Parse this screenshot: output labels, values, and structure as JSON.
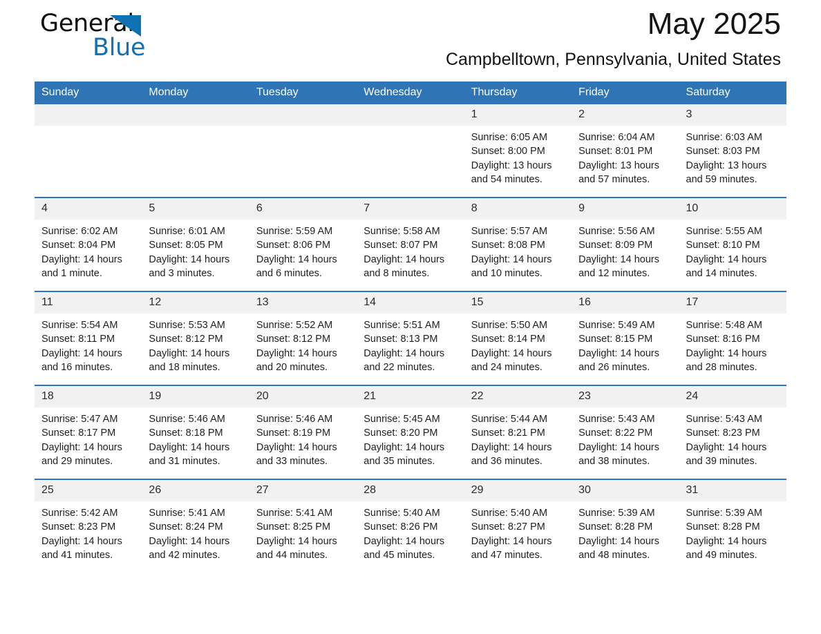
{
  "brand": {
    "name_part1": "General",
    "name_part2": "Blue",
    "triangle_icon": "triangle-logo-icon",
    "accent_color": "#0f72b5"
  },
  "header": {
    "title": "May 2025",
    "subtitle": "Campbelltown, Pennsylvania, United States",
    "header_bg_color": "#2f75b5",
    "daynum_bg_color": "#f1f1f1"
  },
  "weekday_headers": [
    "Sunday",
    "Monday",
    "Tuesday",
    "Wednesday",
    "Thursday",
    "Friday",
    "Saturday"
  ],
  "weeks": [
    [
      {
        "day": "",
        "lines": []
      },
      {
        "day": "",
        "lines": []
      },
      {
        "day": "",
        "lines": []
      },
      {
        "day": "",
        "lines": []
      },
      {
        "day": "1",
        "lines": [
          "Sunrise: 6:05 AM",
          "Sunset: 8:00 PM",
          "Daylight: 13 hours and 54 minutes."
        ]
      },
      {
        "day": "2",
        "lines": [
          "Sunrise: 6:04 AM",
          "Sunset: 8:01 PM",
          "Daylight: 13 hours and 57 minutes."
        ]
      },
      {
        "day": "3",
        "lines": [
          "Sunrise: 6:03 AM",
          "Sunset: 8:03 PM",
          "Daylight: 13 hours and 59 minutes."
        ]
      }
    ],
    [
      {
        "day": "4",
        "lines": [
          "Sunrise: 6:02 AM",
          "Sunset: 8:04 PM",
          "Daylight: 14 hours and 1 minute."
        ]
      },
      {
        "day": "5",
        "lines": [
          "Sunrise: 6:01 AM",
          "Sunset: 8:05 PM",
          "Daylight: 14 hours and 3 minutes."
        ]
      },
      {
        "day": "6",
        "lines": [
          "Sunrise: 5:59 AM",
          "Sunset: 8:06 PM",
          "Daylight: 14 hours and 6 minutes."
        ]
      },
      {
        "day": "7",
        "lines": [
          "Sunrise: 5:58 AM",
          "Sunset: 8:07 PM",
          "Daylight: 14 hours and 8 minutes."
        ]
      },
      {
        "day": "8",
        "lines": [
          "Sunrise: 5:57 AM",
          "Sunset: 8:08 PM",
          "Daylight: 14 hours and 10 minutes."
        ]
      },
      {
        "day": "9",
        "lines": [
          "Sunrise: 5:56 AM",
          "Sunset: 8:09 PM",
          "Daylight: 14 hours and 12 minutes."
        ]
      },
      {
        "day": "10",
        "lines": [
          "Sunrise: 5:55 AM",
          "Sunset: 8:10 PM",
          "Daylight: 14 hours and 14 minutes."
        ]
      }
    ],
    [
      {
        "day": "11",
        "lines": [
          "Sunrise: 5:54 AM",
          "Sunset: 8:11 PM",
          "Daylight: 14 hours and 16 minutes."
        ]
      },
      {
        "day": "12",
        "lines": [
          "Sunrise: 5:53 AM",
          "Sunset: 8:12 PM",
          "Daylight: 14 hours and 18 minutes."
        ]
      },
      {
        "day": "13",
        "lines": [
          "Sunrise: 5:52 AM",
          "Sunset: 8:12 PM",
          "Daylight: 14 hours and 20 minutes."
        ]
      },
      {
        "day": "14",
        "lines": [
          "Sunrise: 5:51 AM",
          "Sunset: 8:13 PM",
          "Daylight: 14 hours and 22 minutes."
        ]
      },
      {
        "day": "15",
        "lines": [
          "Sunrise: 5:50 AM",
          "Sunset: 8:14 PM",
          "Daylight: 14 hours and 24 minutes."
        ]
      },
      {
        "day": "16",
        "lines": [
          "Sunrise: 5:49 AM",
          "Sunset: 8:15 PM",
          "Daylight: 14 hours and 26 minutes."
        ]
      },
      {
        "day": "17",
        "lines": [
          "Sunrise: 5:48 AM",
          "Sunset: 8:16 PM",
          "Daylight: 14 hours and 28 minutes."
        ]
      }
    ],
    [
      {
        "day": "18",
        "lines": [
          "Sunrise: 5:47 AM",
          "Sunset: 8:17 PM",
          "Daylight: 14 hours and 29 minutes."
        ]
      },
      {
        "day": "19",
        "lines": [
          "Sunrise: 5:46 AM",
          "Sunset: 8:18 PM",
          "Daylight: 14 hours and 31 minutes."
        ]
      },
      {
        "day": "20",
        "lines": [
          "Sunrise: 5:46 AM",
          "Sunset: 8:19 PM",
          "Daylight: 14 hours and 33 minutes."
        ]
      },
      {
        "day": "21",
        "lines": [
          "Sunrise: 5:45 AM",
          "Sunset: 8:20 PM",
          "Daylight: 14 hours and 35 minutes."
        ]
      },
      {
        "day": "22",
        "lines": [
          "Sunrise: 5:44 AM",
          "Sunset: 8:21 PM",
          "Daylight: 14 hours and 36 minutes."
        ]
      },
      {
        "day": "23",
        "lines": [
          "Sunrise: 5:43 AM",
          "Sunset: 8:22 PM",
          "Daylight: 14 hours and 38 minutes."
        ]
      },
      {
        "day": "24",
        "lines": [
          "Sunrise: 5:43 AM",
          "Sunset: 8:23 PM",
          "Daylight: 14 hours and 39 minutes."
        ]
      }
    ],
    [
      {
        "day": "25",
        "lines": [
          "Sunrise: 5:42 AM",
          "Sunset: 8:23 PM",
          "Daylight: 14 hours and 41 minutes."
        ]
      },
      {
        "day": "26",
        "lines": [
          "Sunrise: 5:41 AM",
          "Sunset: 8:24 PM",
          "Daylight: 14 hours and 42 minutes."
        ]
      },
      {
        "day": "27",
        "lines": [
          "Sunrise: 5:41 AM",
          "Sunset: 8:25 PM",
          "Daylight: 14 hours and 44 minutes."
        ]
      },
      {
        "day": "28",
        "lines": [
          "Sunrise: 5:40 AM",
          "Sunset: 8:26 PM",
          "Daylight: 14 hours and 45 minutes."
        ]
      },
      {
        "day": "29",
        "lines": [
          "Sunrise: 5:40 AM",
          "Sunset: 8:27 PM",
          "Daylight: 14 hours and 47 minutes."
        ]
      },
      {
        "day": "30",
        "lines": [
          "Sunrise: 5:39 AM",
          "Sunset: 8:28 PM",
          "Daylight: 14 hours and 48 minutes."
        ]
      },
      {
        "day": "31",
        "lines": [
          "Sunrise: 5:39 AM",
          "Sunset: 8:28 PM",
          "Daylight: 14 hours and 49 minutes."
        ]
      }
    ]
  ]
}
